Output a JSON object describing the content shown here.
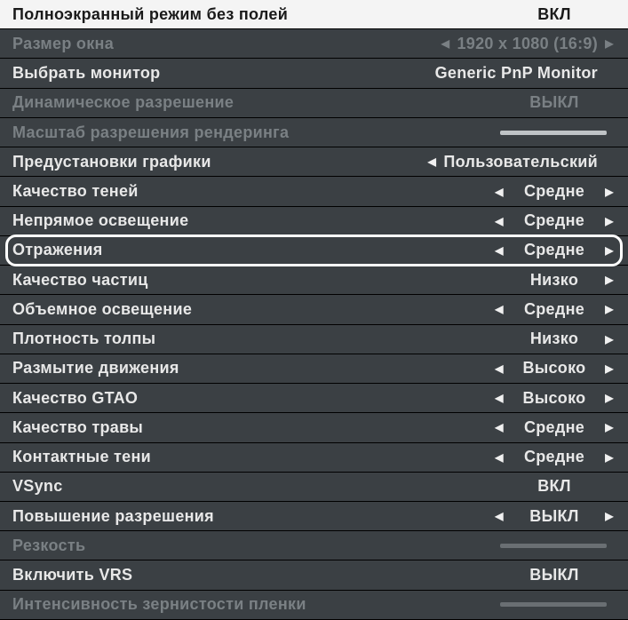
{
  "rows": [
    {
      "id": "fullscreen-borderless",
      "label": "Полноэкранный режим без полей",
      "value": "ВКЛ",
      "header": true,
      "left": false,
      "right": false,
      "interactable": true
    },
    {
      "id": "window-size",
      "label": "Размер окна",
      "value": "1920 x 1080 (16:9)",
      "disabled": true,
      "left": true,
      "right": true,
      "interactable": false
    },
    {
      "id": "select-monitor",
      "label": "Выбрать монитор",
      "value": "Generic PnP Monitor",
      "left": false,
      "right": false,
      "interactable": true
    },
    {
      "id": "dynamic-resolution",
      "label": "Динамическое разрешение",
      "value": "ВЫКЛ",
      "disabled": true,
      "left": false,
      "right": false,
      "interactable": false
    },
    {
      "id": "render-scale",
      "label": "Масштаб разрешения рендеринга",
      "slider": true,
      "sliderFill": "full",
      "disabled": true,
      "interactable": false
    },
    {
      "id": "graphics-preset",
      "label": "Предустановки графики",
      "value": "Пользовательский",
      "left": true,
      "right": false,
      "interactable": true
    },
    {
      "id": "shadow-quality",
      "label": "Качество теней",
      "value": "Средне",
      "left": true,
      "right": true,
      "interactable": true
    },
    {
      "id": "indirect-lighting",
      "label": "Непрямое освещение",
      "value": "Средне",
      "left": true,
      "right": true,
      "interactable": true
    },
    {
      "id": "reflections",
      "label": "Отражения",
      "value": "Средне",
      "left": true,
      "right": true,
      "highlighted": true,
      "interactable": true
    },
    {
      "id": "particle-quality",
      "label": "Качество частиц",
      "value": "Низко",
      "left": false,
      "right": true,
      "interactable": true
    },
    {
      "id": "volumetric-lighting",
      "label": "Объемное освещение",
      "value": "Средне",
      "left": true,
      "right": true,
      "interactable": true
    },
    {
      "id": "crowd-density",
      "label": "Плотность толпы",
      "value": "Низко",
      "left": false,
      "right": true,
      "interactable": true
    },
    {
      "id": "motion-blur",
      "label": "Размытие движения",
      "value": "Высоко",
      "left": true,
      "right": true,
      "interactable": true
    },
    {
      "id": "gtao-quality",
      "label": "Качество GTAO",
      "value": "Высоко",
      "left": true,
      "right": true,
      "interactable": true
    },
    {
      "id": "grass-quality",
      "label": "Качество травы",
      "value": "Средне",
      "left": true,
      "right": true,
      "interactable": true
    },
    {
      "id": "contact-shadows",
      "label": "Контактные тени",
      "value": "Средне",
      "left": true,
      "right": true,
      "interactable": true
    },
    {
      "id": "vsync",
      "label": "VSync",
      "value": "ВКЛ",
      "left": false,
      "right": false,
      "interactable": true
    },
    {
      "id": "resolution-upscale",
      "label": "Повышение разрешения",
      "value": "ВЫКЛ",
      "left": true,
      "right": true,
      "interactable": true
    },
    {
      "id": "sharpness",
      "label": "Резкость",
      "slider": true,
      "sliderFill": "none",
      "disabled": true,
      "interactable": false
    },
    {
      "id": "vrs-enable",
      "label": "Включить VRS",
      "value": "ВЫКЛ",
      "left": false,
      "right": false,
      "interactable": true
    },
    {
      "id": "film-grain",
      "label": "Интенсивность зернистости пленки",
      "slider": true,
      "sliderFill": "none",
      "disabled": true,
      "interactable": false
    }
  ]
}
